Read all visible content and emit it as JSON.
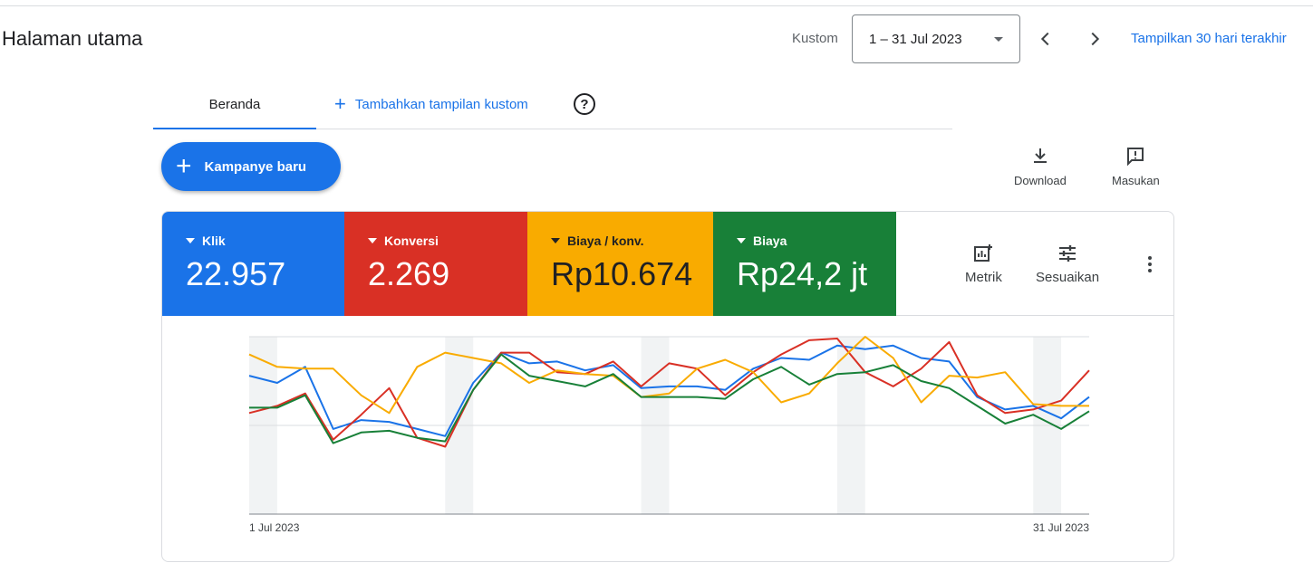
{
  "header": {
    "title": "Halaman utama",
    "range_type": "Kustom",
    "date_range": "1 – 31 Jul 2023",
    "last30_link": "Tampilkan 30 hari terakhir"
  },
  "tabs": {
    "home": "Beranda",
    "add_custom": "Tambahkan tampilan kustom"
  },
  "actions": {
    "new_campaign": "Kampanye baru",
    "download": "Download",
    "feedback": "Masukan"
  },
  "metrics": [
    {
      "label": "Klik",
      "value": "22.957",
      "color": "#1a73e8"
    },
    {
      "label": "Konversi",
      "value": "2.269",
      "color": "#d93025"
    },
    {
      "label": "Biaya / konv.",
      "value": "Rp10.674",
      "color": "#f9ab00"
    },
    {
      "label": "Biaya",
      "value": "Rp24,2 jt",
      "color": "#188038"
    }
  ],
  "card_tools": {
    "metrics_label": "Metrik",
    "customize_label": "Sesuaikan"
  },
  "chart_data": {
    "type": "line",
    "x": [
      "1 Jul",
      "2 Jul",
      "3 Jul",
      "4 Jul",
      "5 Jul",
      "6 Jul",
      "7 Jul",
      "8 Jul",
      "9 Jul",
      "10 Jul",
      "11 Jul",
      "12 Jul",
      "13 Jul",
      "14 Jul",
      "15 Jul",
      "16 Jul",
      "17 Jul",
      "18 Jul",
      "19 Jul",
      "20 Jul",
      "21 Jul",
      "22 Jul",
      "23 Jul",
      "24 Jul",
      "25 Jul",
      "26 Jul",
      "27 Jul",
      "28 Jul",
      "29 Jul",
      "30 Jul",
      "31 Jul"
    ],
    "x_tick_labels": [
      "1 Jul 2023",
      "31 Jul 2023"
    ],
    "ylim": [
      0,
      100
    ],
    "grid": true,
    "weekend_bands": [
      "1 Jul",
      "8 Jul",
      "15 Jul",
      "22 Jul",
      "29 Jul"
    ],
    "series": [
      {
        "color": "#1a73e8",
        "values": [
          78,
          74,
          83,
          48,
          53,
          52,
          48,
          44,
          74,
          91,
          85,
          86,
          81,
          84,
          71,
          72,
          72,
          70,
          82,
          88,
          87,
          95,
          93,
          95,
          88,
          86,
          66,
          59,
          61,
          54,
          66
        ]
      },
      {
        "color": "#d93025",
        "values": [
          57,
          61,
          68,
          42,
          56,
          71,
          43,
          38,
          70,
          91,
          91,
          80,
          79,
          86,
          72,
          85,
          82,
          67,
          80,
          90,
          98,
          99,
          80,
          72,
          82,
          97,
          67,
          57,
          59,
          64,
          81
        ]
      },
      {
        "color": "#f9ab00",
        "values": [
          90,
          83,
          82,
          82,
          67,
          57,
          83,
          91,
          88,
          85,
          74,
          81,
          79,
          78,
          66,
          68,
          82,
          87,
          80,
          63,
          68,
          85,
          100,
          88,
          63,
          78,
          77,
          80,
          62,
          61,
          61
        ]
      },
      {
        "color": "#188038",
        "values": [
          60,
          60,
          67,
          40,
          46,
          47,
          43,
          41,
          70,
          90,
          78,
          75,
          72,
          79,
          66,
          66,
          66,
          65,
          76,
          83,
          73,
          79,
          80,
          84,
          75,
          71,
          61,
          51,
          56,
          48,
          58
        ]
      }
    ]
  }
}
